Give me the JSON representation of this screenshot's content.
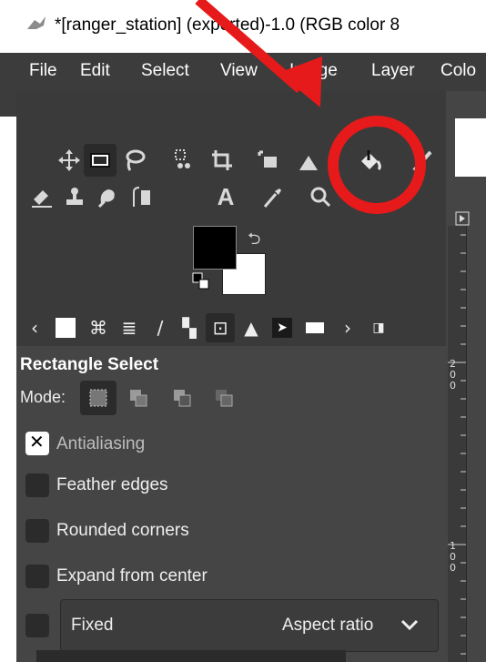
{
  "window": {
    "title": "*[ranger_station] (exported)-1.0 (RGB color 8"
  },
  "menubar": {
    "items": [
      "File",
      "Edit",
      "Select",
      "View",
      "Image",
      "Layer",
      "Colo"
    ]
  },
  "tool_options": {
    "title": "Rectangle Select",
    "mode_label": "Mode:",
    "antialiasing": "Antialiasing",
    "feather": "Feather edges",
    "rounded": "Rounded corners",
    "expand": "Expand from center",
    "fixed": "Fixed",
    "aspect": "Aspect ratio"
  },
  "ruler": {
    "labels": [
      "2\n0\n0",
      "1\n0\n0"
    ]
  },
  "colors": {
    "annotation": "#e61a1a",
    "panel": "#454545",
    "toolbox": "#3a3a3a"
  },
  "annotation": {
    "arrow_color": "#e61a1a",
    "circle_color": "#e61a1a",
    "target": "bucket-fill-tool"
  }
}
